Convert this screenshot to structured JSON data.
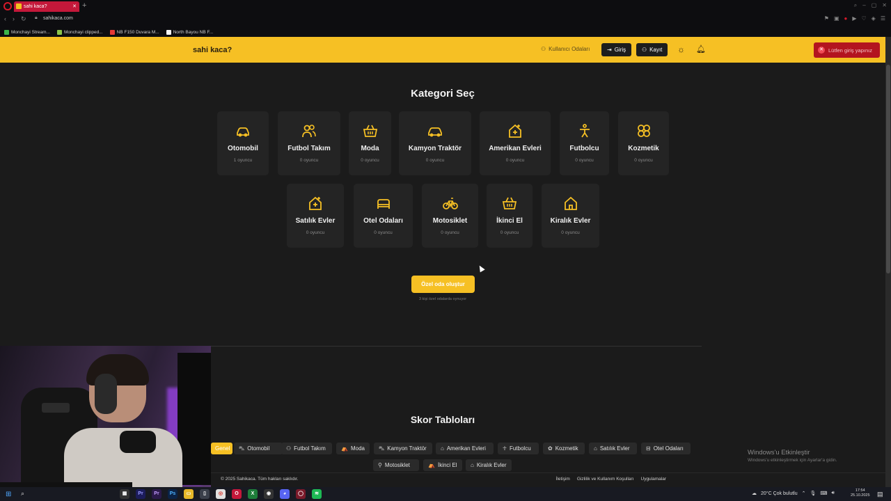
{
  "browser": {
    "tab_title": "sahi kaca?",
    "url": "sahikaca.com",
    "bookmarks": [
      "Monchayi Stream...",
      "Monchayi clipped...",
      "NB F150 Duvara M...",
      "North Bayou NB F..."
    ]
  },
  "header": {
    "brand": "sahi kaca?",
    "rooms_link": "Kullanıcı Odaları",
    "login_label": "Giriş",
    "register_label": "Kayıt",
    "toast": "Lütfen giriş yapınız"
  },
  "categories": {
    "title": "Kategori Seç",
    "items": [
      {
        "name": "Otomobil",
        "count": "1 oyuncu",
        "icon": "car-icon"
      },
      {
        "name": "Futbol Takım",
        "count": "0 oyuncu",
        "icon": "users-icon"
      },
      {
        "name": "Moda",
        "count": "0 oyuncu",
        "icon": "basket-icon"
      },
      {
        "name": "Kamyon Traktör",
        "count": "0 oyuncu",
        "icon": "truck-icon"
      },
      {
        "name": "Amerikan Evleri",
        "count": "0 oyuncu",
        "icon": "house-plus-icon"
      },
      {
        "name": "Futbolcu",
        "count": "0 oyuncu",
        "icon": "person-icon"
      },
      {
        "name": "Kozmetik",
        "count": "0 oyuncu",
        "icon": "flower-icon"
      },
      {
        "name": "Satılık Evler",
        "count": "0 oyuncu",
        "icon": "house-plus-icon"
      },
      {
        "name": "Otel Odaları",
        "count": "0 oyuncu",
        "icon": "bed-icon"
      },
      {
        "name": "Motosiklet",
        "count": "0 oyuncu",
        "icon": "bike-icon"
      },
      {
        "name": "İkinci El",
        "count": "0 oyuncu",
        "icon": "basket-icon"
      },
      {
        "name": "Kiralık Evler",
        "count": "0 oyuncu",
        "icon": "home-icon"
      }
    ]
  },
  "private_room": {
    "button": "Özel oda oluştur",
    "note": "3 kişi özel odalarda oynuyor"
  },
  "scoreboard": {
    "title": "Skor Tabloları",
    "tabs": [
      "Genel",
      "Otomobil",
      "Futbol Takım",
      "Moda",
      "Kamyon Traktör",
      "Amerikan Evleri",
      "Futbolcu",
      "Kozmetik",
      "Satılık Evler",
      "Otel Odaları",
      "Motosiklet",
      "İkinci El",
      "Kiralık Evler"
    ]
  },
  "footer": {
    "copyright": "© 2025 Sahikaca. Tüm hakları saklıdır.",
    "links": [
      "İletişim",
      "Gizlilik ve Kullanım Koşulları",
      "Uygulamalar"
    ]
  },
  "windows": {
    "activate_title": "Windows'u Etkinleştir",
    "activate_sub": "Windows'u etkinleştirmek için Ayarlar'a gidin.",
    "weather": "20°C  Çok bulutlu",
    "time": "17:54",
    "date": "25.10.2025"
  },
  "colors": {
    "accent": "#f6c024",
    "background": "#1b1b1b",
    "card": "#242424",
    "toast": "#b3141f"
  }
}
